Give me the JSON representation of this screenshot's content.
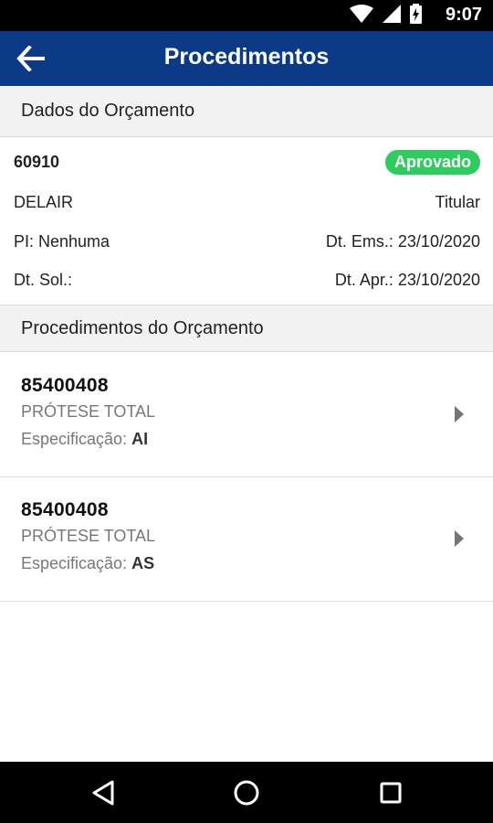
{
  "status_bar": {
    "time": "9:07",
    "icons": [
      "wifi-icon",
      "signal-icon",
      "battery-charging-icon"
    ]
  },
  "app_bar": {
    "title": "Procedimentos",
    "back_icon": "arrow-left-icon"
  },
  "budget": {
    "section_title": "Dados do Orçamento",
    "number": "60910",
    "status": "Aprovado",
    "status_color": "#2ecc5f",
    "name": "DELAIR",
    "role": "Titular",
    "pi": "PI: Nenhuma",
    "dt_ems": "Dt. Ems.: 23/10/2020",
    "dt_sol": "Dt. Sol.:",
    "dt_apr": "Dt. Apr.: 23/10/2020"
  },
  "procedures": {
    "section_title": "Procedimentos do Orçamento",
    "spec_label": "Especificação:",
    "items": [
      {
        "code": "85400408",
        "description": "PRÓTESE TOTAL",
        "spec": "AI"
      },
      {
        "code": "85400408",
        "description": "PRÓTESE TOTAL",
        "spec": "AS"
      }
    ]
  },
  "nav_bar": {
    "buttons": [
      "back-triangle-icon",
      "home-circle-icon",
      "recents-square-icon"
    ]
  },
  "colors": {
    "app_bar": "#0b3a86",
    "section_bg": "#f2f2f2"
  }
}
